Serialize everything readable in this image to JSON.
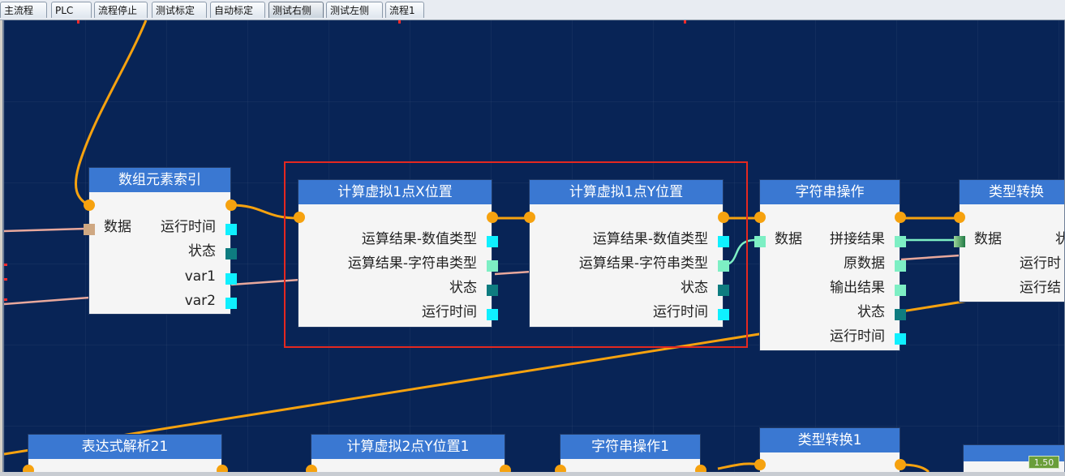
{
  "tabs": [
    {
      "label": "主流程",
      "active": false
    },
    {
      "label": "PLC",
      "active": false
    },
    {
      "label": "流程停止",
      "active": false
    },
    {
      "label": "测试标定",
      "active": false
    },
    {
      "label": "自动标定",
      "active": false
    },
    {
      "label": "测试右侧",
      "active": true
    },
    {
      "label": "测试左侧",
      "active": false
    },
    {
      "label": "流程1",
      "active": false
    }
  ],
  "nodes": {
    "array_index": {
      "title": "数组元素索引",
      "in_data": "数据",
      "out_runtime": "运行时间",
      "out_status": "状态",
      "out_var1": "var1",
      "out_var2": "var2"
    },
    "calc_x": {
      "title": "计算虚拟1点X位置",
      "out_num": "运算结果-数值类型",
      "out_str": "运算结果-字符串类型",
      "out_status": "状态",
      "out_runtime": "运行时间"
    },
    "calc_y": {
      "title": "计算虚拟1点Y位置",
      "out_num": "运算结果-数值类型",
      "out_str": "运算结果-字符串类型",
      "out_status": "状态",
      "out_runtime": "运行时间"
    },
    "string_op": {
      "title": "字符串操作",
      "in_data": "数据",
      "out_join": "拼接结果",
      "out_raw": "原数据",
      "out_result": "输出结果",
      "out_status": "状态",
      "out_runtime": "运行时间"
    },
    "type_convert": {
      "title": "类型转换",
      "in_data": "数据",
      "out_status": "状态",
      "out_runtime": "运行时间",
      "out_result": "运行结果"
    },
    "expr21": {
      "title": "表达式解析21"
    },
    "calc2y": {
      "title": "计算虚拟2点Y位置1"
    },
    "string_op1": {
      "title": "字符串操作1"
    },
    "type_convert1": {
      "title": "类型转换1"
    }
  },
  "partial_labels": {
    "type_convert_status": "状",
    "type_convert_runtime": "运行时",
    "type_convert_result": "运行结"
  },
  "zoom": "1.50",
  "colors": {
    "canvas": "#082456",
    "node_header": "#3a78d2",
    "flow_wire": "#f6a20f",
    "data_wire": "#e8a89c",
    "selection": "#e42820"
  }
}
